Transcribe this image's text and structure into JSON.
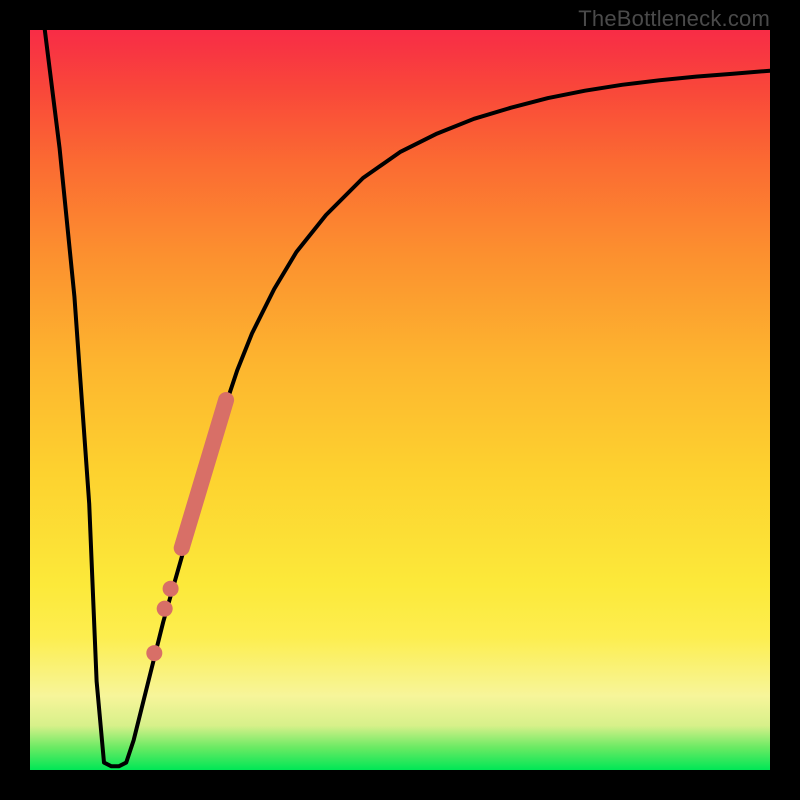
{
  "watermark": "TheBottleneck.com",
  "colors": {
    "frame": "#000000",
    "curve": "#000000",
    "marker": "#d86f67",
    "gradient_stops": [
      {
        "pct": 0,
        "hex": "#00e756"
      },
      {
        "pct": 3,
        "hex": "#69ea63"
      },
      {
        "pct": 6,
        "hex": "#d7f08a"
      },
      {
        "pct": 10,
        "hex": "#f7f59a"
      },
      {
        "pct": 18,
        "hex": "#fdee4f"
      },
      {
        "pct": 25,
        "hex": "#fce93a"
      },
      {
        "pct": 40,
        "hex": "#fdd22f"
      },
      {
        "pct": 55,
        "hex": "#fdb52f"
      },
      {
        "pct": 70,
        "hex": "#fc8f2f"
      },
      {
        "pct": 82,
        "hex": "#fb6b32"
      },
      {
        "pct": 92,
        "hex": "#f9473a"
      },
      {
        "pct": 100,
        "hex": "#f82c46"
      }
    ]
  },
  "chart_data": {
    "type": "line",
    "title": "",
    "xlabel": "",
    "ylabel": "",
    "xlim": [
      0,
      100
    ],
    "ylim": [
      0,
      100
    ],
    "x": [
      2,
      4,
      6,
      8,
      9,
      10,
      11,
      12,
      13,
      14,
      16,
      18,
      20,
      22,
      24,
      26,
      28,
      30,
      33,
      36,
      40,
      45,
      50,
      55,
      60,
      65,
      70,
      75,
      80,
      85,
      90,
      95,
      100
    ],
    "y": [
      100,
      84,
      64,
      36,
      12,
      1,
      0.5,
      0.5,
      1,
      4,
      12,
      20,
      27,
      34,
      42,
      48,
      54,
      59,
      65,
      70,
      75,
      80,
      83.5,
      86,
      88,
      89.5,
      90.8,
      91.8,
      92.6,
      93.2,
      93.7,
      94.1,
      94.5
    ],
    "markers": {
      "segment": {
        "x1": 20.5,
        "y1": 30,
        "x2": 26.5,
        "y2": 50
      },
      "points": [
        {
          "x": 19.0,
          "y": 24.5
        },
        {
          "x": 18.2,
          "y": 21.8
        },
        {
          "x": 16.8,
          "y": 15.8
        }
      ]
    }
  }
}
